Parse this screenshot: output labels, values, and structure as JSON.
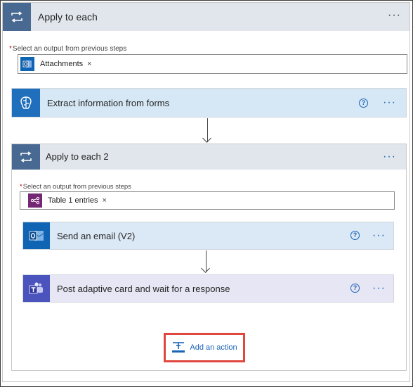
{
  "outer_loop": {
    "title": "Apply to each",
    "more_label": "···",
    "select_label": "Select an output from previous steps",
    "required_mark": "*",
    "token": {
      "label": "Attachments",
      "remove": "×",
      "icon": "outlook-icon"
    }
  },
  "extract_action": {
    "title": "Extract information from forms",
    "help": "?",
    "more_label": "···",
    "icon": "ai-builder-icon"
  },
  "inner_loop": {
    "title": "Apply to each 2",
    "more_label": "···",
    "select_label": "Select an output from previous steps",
    "required_mark": "*",
    "token": {
      "label": "Table 1 entries",
      "remove": "×",
      "icon": "ai-builder-token-icon"
    }
  },
  "email_action": {
    "title": "Send an email (V2)",
    "help": "?",
    "more_label": "···",
    "icon": "outlook-icon"
  },
  "teams_action": {
    "title": "Post adaptive card and wait for a response",
    "help": "?",
    "more_label": "···",
    "icon": "teams-icon"
  },
  "add_action": {
    "label": "Add an action",
    "icon": "add-action-icon"
  },
  "colors": {
    "loop_header": "#e1e6ec",
    "loop_icon": "#486991",
    "extract_card": "#d6e8f5",
    "extract_icon": "#1f6fbd",
    "email_card": "#dbe8f5",
    "email_icon": "#0f64b4",
    "teams_card": "#e7e6f4",
    "teams_icon": "#4b53bc",
    "highlight": "#e0473f"
  }
}
